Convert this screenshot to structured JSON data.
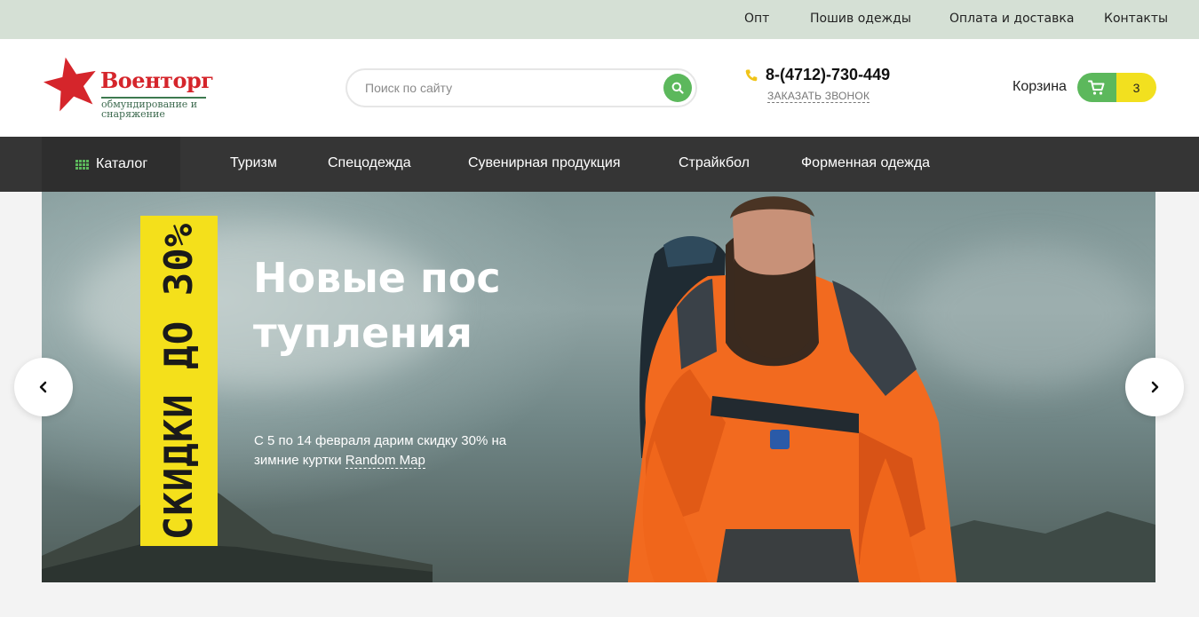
{
  "topbar": {
    "links": [
      "Опт",
      "Пошив одежды",
      "Оплата и доставка",
      "Контакты"
    ]
  },
  "logo": {
    "title": "Военторг",
    "subtitle": "обмундирование и снаряжение"
  },
  "search": {
    "placeholder": "Поиск по сайту",
    "value": ""
  },
  "contact": {
    "phone": "8-(4712)-730-449",
    "callback": "ЗАКАЗАТЬ ЗВОНОК"
  },
  "cart": {
    "label": "Корзина",
    "count": "3"
  },
  "nav": {
    "catalog": "Каталог",
    "items": [
      "Туризм",
      "Спецодежда",
      "Сувенирная продукция",
      "Страйкбол",
      "Форменная одежда"
    ]
  },
  "hero": {
    "badge": "СКИДКИ ДО 30%",
    "title": "Новые поступления",
    "text_prefix": "С 5 по 14 февраля дарим скидку 30% на зимние куртки ",
    "link": "Random Map"
  },
  "icons": {
    "logo": "red-star-icon",
    "search": "search-icon",
    "phone": "phone-icon",
    "cart": "cart-icon",
    "catalog": "grid-icon",
    "prev": "chevron-left-icon",
    "next": "chevron-right-icon"
  },
  "colors": {
    "topbar_bg": "#d5e0d5",
    "accent_green": "#5cb85c",
    "accent_yellow": "#f2e01f",
    "nav_bg": "#353535",
    "logo_red": "#d5252b"
  }
}
